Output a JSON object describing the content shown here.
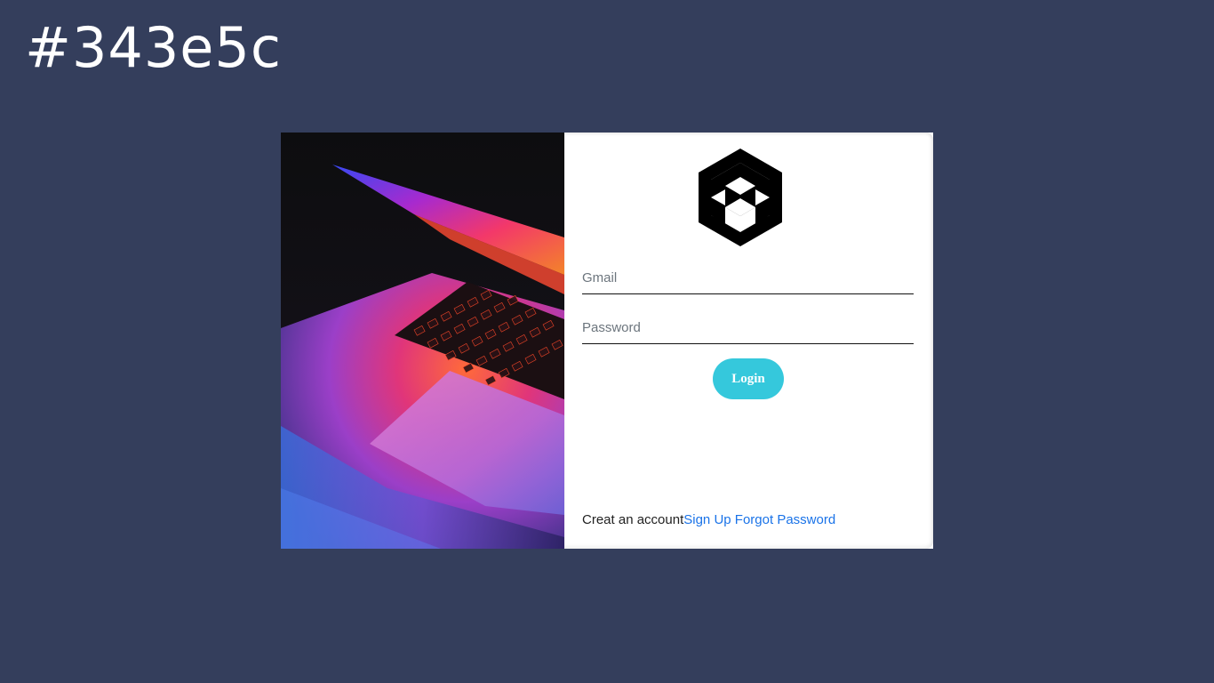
{
  "header": {
    "hex_text": "#343e5c"
  },
  "colors": {
    "page_background": "#343e5c",
    "button_background": "#35c8dc",
    "link_color": "#1a73e8"
  },
  "hero": {
    "image": "laptop-keyboard-photo"
  },
  "login_form": {
    "logo_icon": "hexagon-cube-logo-icon",
    "gmail_placeholder": "Gmail",
    "password_placeholder": "Password",
    "login_label": "Login",
    "create_account_text": "Creat an account",
    "sign_up_link": "Sign Up",
    "forgot_password_link": "Forgot Password"
  }
}
